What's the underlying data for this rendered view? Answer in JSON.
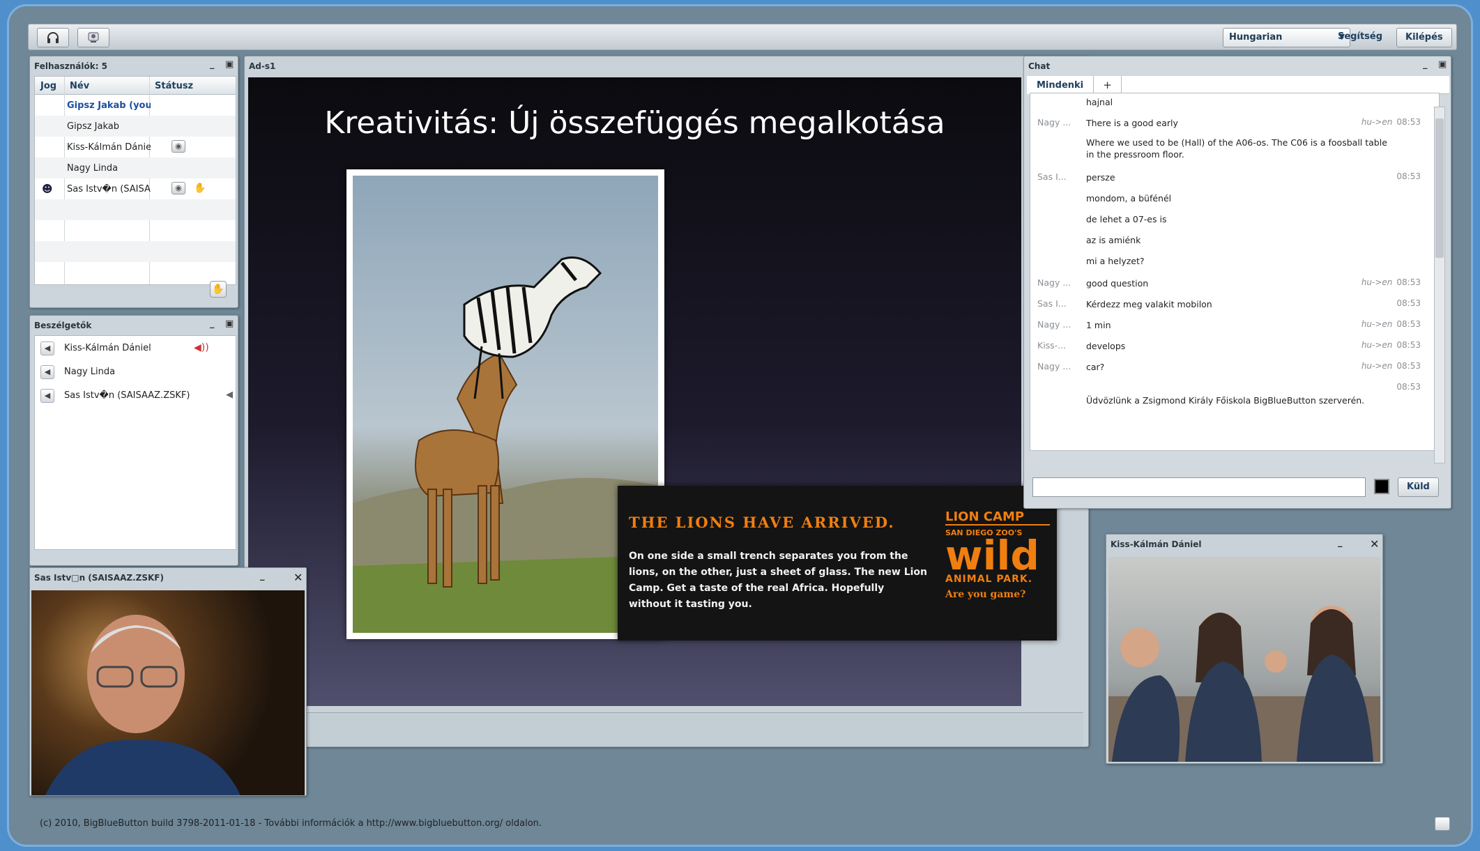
{
  "toolbar": {
    "lang": "Hungarian",
    "help": "Segítség",
    "logout": "Kilépés"
  },
  "users": {
    "title": "Felhasználók: 5",
    "cols": [
      "Jog",
      "Név",
      "Státusz"
    ],
    "rows": [
      "Gipsz Jakab (you)",
      "Gipsz Jakab",
      "Kiss-Kálmán Dániel",
      "Nagy Linda",
      "Sas Istv�n (SAISAAZ.ZSKF)"
    ]
  },
  "talkers": {
    "title": "Beszélgetők",
    "rows": [
      "Kiss-Kálmán Dániel",
      "Nagy Linda",
      "Sas Istv�n (SAISAAZ.ZSKF)"
    ]
  },
  "presentation": {
    "title": "Ad-s1",
    "slide_title": "Kreativitás:  Új összefüggés megalkotása",
    "ad_heading": "THE LIONS HAVE ARRIVED.",
    "ad_text": "On one side a small trench separates you from the lions, on the other, just a sheet of glass. The new Lion Camp. Get a taste of the real Africa. Hopefully without it tasting you.",
    "ad_logo_top": "LION CAMP",
    "ad_logo_small": "SAN DIEGO ZOO'S",
    "ad_logo_big": "wild",
    "ad_logo_sub": "ANIMAL PARK.",
    "ad_logo_q": "Are you game?"
  },
  "chat": {
    "title": "Chat",
    "tab": "Mindenki",
    "tab_add": "+",
    "send": "Küld",
    "messages": [
      {
        "who": "",
        "text": "hajnal",
        "tr": "",
        "time": ""
      },
      {
        "who": "Nagy ...",
        "text": "There is a good early",
        "tr": "hu->en",
        "time": "08:53"
      },
      {
        "who": "",
        "text": "Where we used to be (Hall) of the A06-os. The C06 is a foosball table in the pressroom floor.",
        "tr": "",
        "time": ""
      },
      {
        "who": "Sas I...",
        "text": "persze",
        "tr": "",
        "time": "08:53"
      },
      {
        "who": "",
        "text": "mondom, a büfénél",
        "tr": "",
        "time": ""
      },
      {
        "who": "",
        "text": "de lehet a 07-es is",
        "tr": "",
        "time": ""
      },
      {
        "who": "",
        "text": "az is amiénk",
        "tr": "",
        "time": ""
      },
      {
        "who": "",
        "text": "mi a helyzet?",
        "tr": "",
        "time": ""
      },
      {
        "who": "Nagy ...",
        "text": "good question",
        "tr": "hu->en",
        "time": "08:53"
      },
      {
        "who": "Sas I...",
        "text": "Kérdezz meg valakit mobilon",
        "tr": "",
        "time": "08:53"
      },
      {
        "who": "Nagy ...",
        "text": "1 min",
        "tr": "hu->en",
        "time": "08:53"
      },
      {
        "who": "Kiss-...",
        "text": "develops",
        "tr": "hu->en",
        "time": "08:53"
      },
      {
        "who": "Nagy ...",
        "text": "car?",
        "tr": "hu->en",
        "time": "08:53"
      },
      {
        "who": "",
        "text": "",
        "tr": "",
        "time": "08:53"
      },
      {
        "who": "",
        "text": "Üdvözlünk a Zsigmond Király Főiskola BigBlueButton szerverén.",
        "tr": "",
        "time": ""
      }
    ]
  },
  "video1": {
    "title": "Sas Istv□n (SAISAAZ.ZSKF)"
  },
  "video2": {
    "title": "Kiss-Kálmán Dániel"
  },
  "footer": "(c) 2010, BigBlueButton build 3798-2011-01-18 - További információk a http://www.bigbluebutton.org/ oldalon."
}
